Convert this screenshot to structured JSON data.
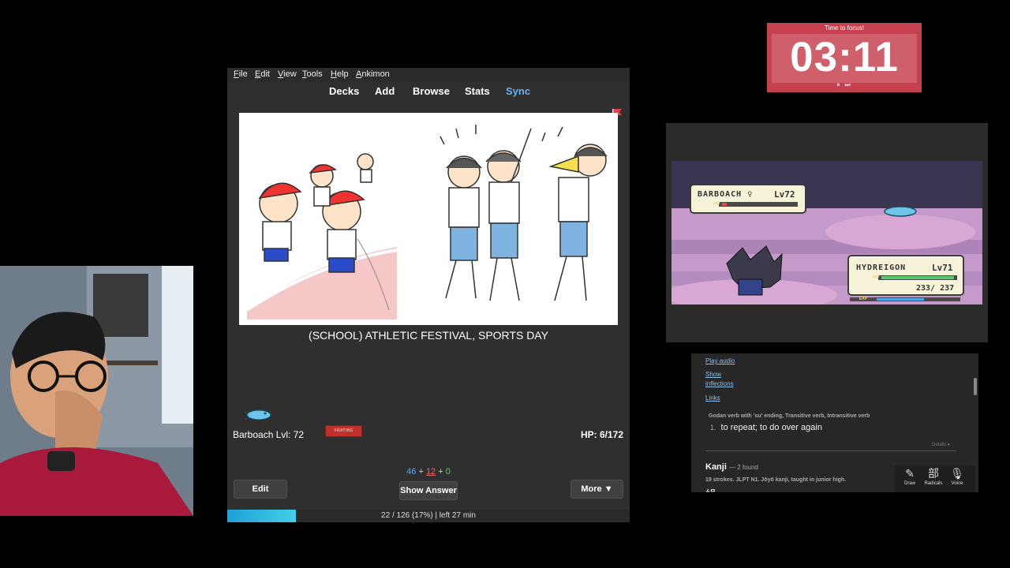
{
  "timer": {
    "title": "Time to focus!",
    "time": "03:11",
    "controls": "⏸ ⏭"
  },
  "anki": {
    "menu": [
      "File",
      "Edit",
      "View",
      "Tools",
      "Help",
      "Ankimon"
    ],
    "toolbar": {
      "decks": "Decks",
      "add": "Add",
      "browse": "Browse",
      "stats": "Stats",
      "sync": "Sync"
    },
    "card_text": "(SCHOOL) ATHLETIC FESTIVAL, SPORTS DAY",
    "pokemon": {
      "name_level": "Barboach Lvl: 72",
      "type": "FIGHTING",
      "hp": "HP: 6/172"
    },
    "counts": {
      "new": "46",
      "learn": "12",
      "review": "0",
      "sep": "+"
    },
    "buttons": {
      "edit": "Edit",
      "show_answer": "Show Answer",
      "more": "More ▼"
    },
    "progress": {
      "fraction": 0.17,
      "text": "22 / 126 (17%) | left 27 min"
    },
    "colors": {
      "sync": "#6ab0f3",
      "flag": "#e0404a",
      "progress": "#2bb5e0"
    }
  },
  "game": {
    "enemy": {
      "name": "BARBOACH",
      "gender": "♀",
      "level": "Lv72"
    },
    "player": {
      "name": "HYDREIGON",
      "level": "Lv71",
      "hp": "233/ 237"
    },
    "exp_label": "EXP",
    "hp_label": "HP"
  },
  "dict": {
    "play_audio": "Play audio",
    "show": "Show",
    "inflections": "inflections",
    "links": "Links",
    "pos": "Godan verb with 'su' ending, Transitive verb, Intransitive verb",
    "def_num": "1.",
    "definition": "to repeat; to do over again",
    "details": "Details ▸",
    "kanji_header": "Kanji",
    "kanji_count": "— 2 found",
    "kanji_info": "19 strokes. JLPT N1. Jōyō kanji, taught in junior high.",
    "kanji_glyph": "繰",
    "tools": [
      {
        "icon": "✎",
        "label": "Draw"
      },
      {
        "icon": "部",
        "label": "Radicals"
      },
      {
        "icon": "🎙",
        "label": "Voice"
      }
    ]
  }
}
